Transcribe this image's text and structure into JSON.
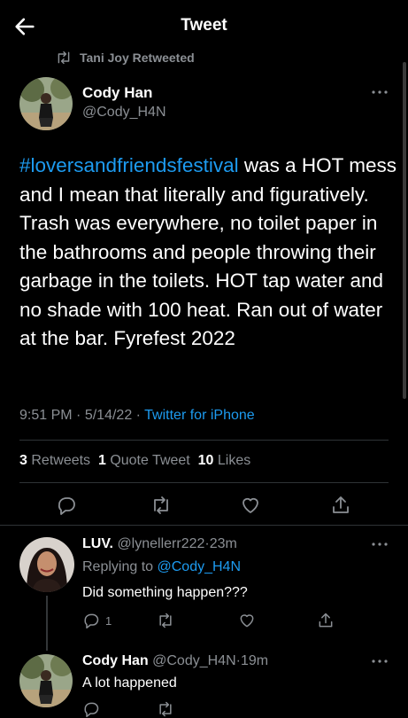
{
  "header": {
    "title": "Tweet"
  },
  "retweet_banner": {
    "text": "Tani Joy Retweeted"
  },
  "tweet": {
    "author_name": "Cody Han",
    "author_handle": "@Cody_H4N",
    "hashtag": "#loversandfriendsfestival",
    "text_rest": " was a HOT mess and I mean that literally and figuratively. Trash was everywhere, no toilet paper in the bathrooms and people throwing their garbage in the toilets. HOT tap water and no shade with 100 heat. Ran out of water at the bar. Fyrefest 2022",
    "time": "9:51 PM",
    "sep1": "·",
    "date": "5/14/22",
    "sep2": "·",
    "source": "Twitter for iPhone",
    "retweets_count": "3",
    "retweets_label": "Retweets",
    "quotes_count": "1",
    "quotes_label": "Quote Tweet",
    "likes_count": "10",
    "likes_label": "Likes"
  },
  "replies": [
    {
      "name": "LUV.",
      "handle": "@lynellerr222",
      "sep": "·",
      "time": "23m",
      "replying_label": "Replying to",
      "replying_to": "@Cody_H4N",
      "text": "Did something happen???",
      "reply_count": "1"
    },
    {
      "name": "Cody Han",
      "handle": "@Cody_H4N",
      "sep": "·",
      "time": "19m",
      "text": "A lot happened"
    }
  ],
  "colors": {
    "accent": "#1d9bf0",
    "muted": "#8b8f94",
    "background": "#000000"
  },
  "icons": [
    "back-arrow-icon",
    "retweet-icon",
    "more-icon",
    "reply-icon",
    "like-icon",
    "share-icon"
  ]
}
